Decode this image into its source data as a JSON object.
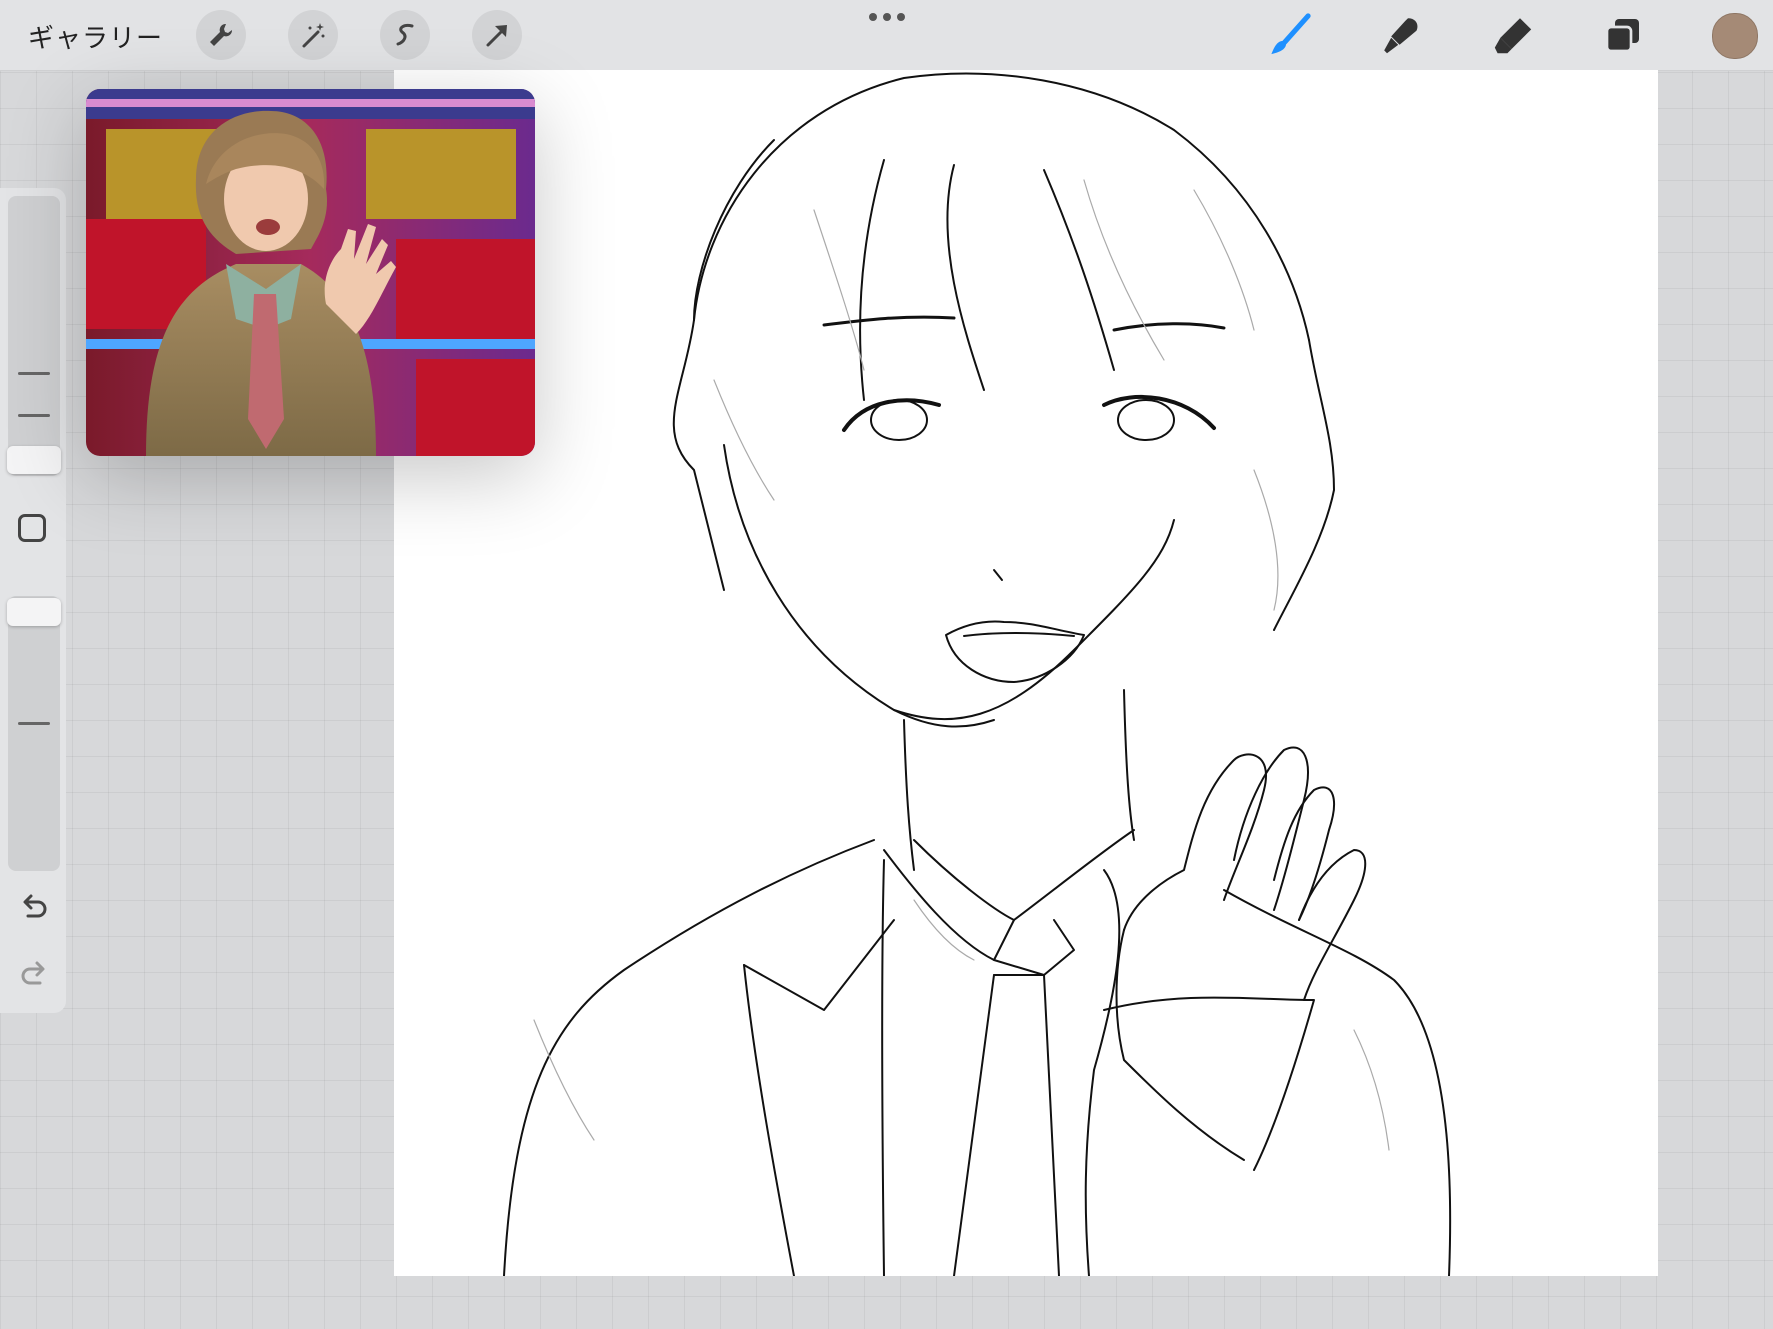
{
  "toolbar": {
    "gallery_label": "ギャラリー",
    "left_tools": [
      "wrench-icon",
      "magic-wand-icon",
      "selection-icon",
      "transform-arrow-icon"
    ],
    "right_tools": [
      "brush-icon",
      "smudge-icon",
      "eraser-icon",
      "layers-icon"
    ],
    "accent_color": "#1e90ff",
    "current_color": "#a58a76"
  },
  "sidebar": {
    "controls": [
      "brush-size-slider",
      "modify-button",
      "opacity-slider",
      "undo-icon",
      "redo-icon"
    ]
  },
  "reference": {
    "kind": "photo-reference"
  },
  "canvas": {
    "content": "line-art-drawing"
  }
}
